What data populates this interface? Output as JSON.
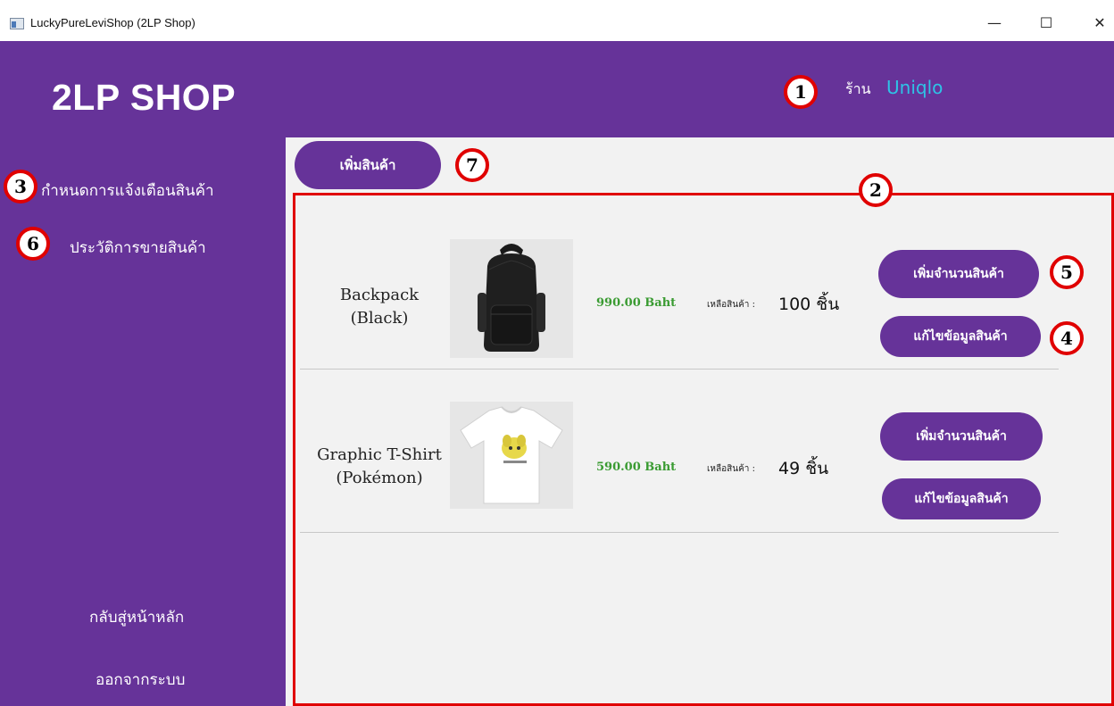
{
  "window": {
    "title": "LuckyPureLeviShop (2LP Shop)",
    "minimize": "—",
    "maximize": "☐",
    "close": "✕"
  },
  "header": {
    "logo": "2LP SHOP",
    "shop_prefix": "ร้าน",
    "shop_name": "Uniqlo"
  },
  "sidebar": {
    "items": [
      {
        "label": "กำหนดการแจ้งเตือนสินค้า"
      },
      {
        "label": "ประวัติการขายสินค้า"
      }
    ],
    "home": "กลับสู่หน้าหลัก",
    "logout": "ออกจากระบบ"
  },
  "main": {
    "add_product": "เพิ่มสินค้า",
    "stock_label": "เหลือสินค้า :",
    "products": [
      {
        "name_line1": "Backpack",
        "name_line2": "(Black)",
        "price": "990.00 Baht",
        "stock_qty": "100 ชิ้น",
        "add_stock": "เพิ่มจำนวนสินค้า",
        "edit": "แก้ไขข้อมูลสินค้า",
        "image": "backpack-black"
      },
      {
        "name_line1": "Graphic T-Shirt",
        "name_line2": "(Pokémon)",
        "price": "590.00 Baht",
        "stock_qty": "49 ชิ้น",
        "add_stock": "เพิ่มจำนวนสินค้า",
        "edit": "แก้ไขข้อมูลสินค้า",
        "image": "tshirt-pokemon"
      }
    ]
  },
  "callouts": [
    "1",
    "2",
    "3",
    "4",
    "5",
    "6",
    "7"
  ],
  "colors": {
    "primary": "#663399",
    "accent": "#2ec3e6",
    "price": "#3a9b32",
    "callout": "#e00000"
  }
}
